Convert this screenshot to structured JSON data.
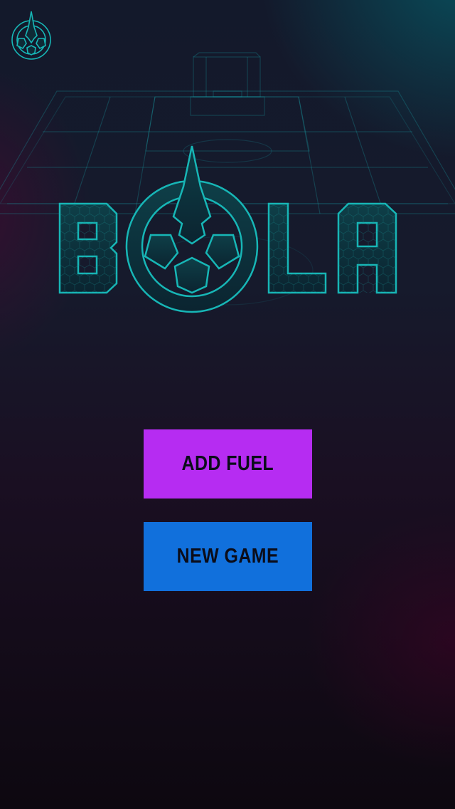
{
  "title": "BOLA",
  "menu": {
    "add_fuel_label": "ADD FUEL",
    "new_game_label": "NEW GAME"
  },
  "colors": {
    "accent": "#17b6b6",
    "add_fuel": "#b62cf2",
    "new_game": "#1170dc",
    "button_text": "#0b0d1a"
  },
  "icons": {
    "corner": "bola-emblem-icon",
    "logo": "bola-logo"
  }
}
